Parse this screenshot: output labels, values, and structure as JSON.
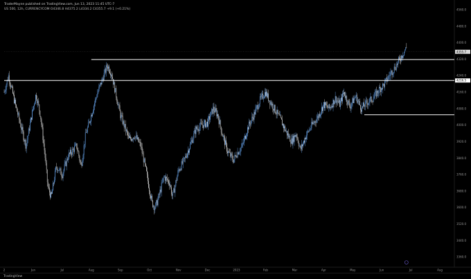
{
  "header": {
    "publisher": "TraderMayne published on TradingView.com, Jun 13, 2023 11:45 UTC-7",
    "ohlc": "US 500, 12h, CURRENCYCOM  O4346.8  H4375.2  L4334.2  C4355.7  +9.1 (+0.21%)"
  },
  "footer": {
    "brand": "TradingView",
    "time_marker": "Jun 13"
  },
  "colors": {
    "background": "#000000",
    "candle_up": "#6fb1ff",
    "candle_down": "#e8e8e8",
    "level_line": "#ffffff",
    "axis_text": "#9a9a9a"
  },
  "chart_data": {
    "type": "candlestick",
    "symbol": "US 500",
    "interval": "12h",
    "ylim": [
      3310,
      4560
    ],
    "y_ticks": [
      "4560.0",
      "4480.0",
      "4400.0",
      "4320.0",
      "4240.0",
      "4160.0",
      "4080.0",
      "4000.0",
      "3920.0",
      "3840.0",
      "3760.0",
      "3680.0",
      "3600.0",
      "3520.0",
      "3440.0",
      "3360.0"
    ],
    "x_ticks": [
      "2",
      "Jun",
      "Jul",
      "Aug",
      "Sep",
      "Oct",
      "Nov",
      "Dec",
      "2023",
      "Feb",
      "Mar",
      "Apr",
      "May",
      "Jun",
      "Jul",
      "Aug"
    ],
    "last_price_label": "4355.7",
    "horizontal_levels": [
      {
        "price": 4318,
        "label": "",
        "from_month": 3.0,
        "to_month": 15.5
      },
      {
        "price": 4216.5,
        "label": "4216.5",
        "from_month": 0.0,
        "to_month": 15.5
      },
      {
        "price": 4050,
        "label": "",
        "from_month": 12.4,
        "to_month": 15.5
      }
    ],
    "close_path": [
      [
        0.0,
        4160
      ],
      [
        0.15,
        4240
      ],
      [
        0.35,
        4120
      ],
      [
        0.55,
        4010
      ],
      [
        0.75,
        3900
      ],
      [
        0.95,
        4050
      ],
      [
        1.1,
        4150
      ],
      [
        1.25,
        4050
      ],
      [
        1.4,
        3860
      ],
      [
        1.5,
        3700
      ],
      [
        1.62,
        3650
      ],
      [
        1.8,
        3800
      ],
      [
        2.0,
        3760
      ],
      [
        2.2,
        3850
      ],
      [
        2.5,
        3900
      ],
      [
        2.65,
        3800
      ],
      [
        2.8,
        3950
      ],
      [
        3.0,
        4050
      ],
      [
        3.2,
        4150
      ],
      [
        3.4,
        4230
      ],
      [
        3.55,
        4290
      ],
      [
        3.7,
        4250
      ],
      [
        3.85,
        4150
      ],
      [
        4.0,
        4050
      ],
      [
        4.15,
        3990
      ],
      [
        4.3,
        3930
      ],
      [
        4.5,
        3950
      ],
      [
        4.7,
        3900
      ],
      [
        4.85,
        3800
      ],
      [
        5.0,
        3690
      ],
      [
        5.1,
        3620
      ],
      [
        5.2,
        3600
      ],
      [
        5.3,
        3640
      ],
      [
        5.5,
        3750
      ],
      [
        5.7,
        3720
      ],
      [
        5.8,
        3650
      ],
      [
        6.0,
        3780
      ],
      [
        6.2,
        3830
      ],
      [
        6.4,
        3900
      ],
      [
        6.6,
        3980
      ],
      [
        6.8,
        4000
      ],
      [
        7.0,
        4010
      ],
      [
        7.2,
        4080
      ],
      [
        7.35,
        4050
      ],
      [
        7.5,
        3960
      ],
      [
        7.7,
        3870
      ],
      [
        7.9,
        3830
      ],
      [
        8.0,
        3860
      ],
      [
        8.2,
        3900
      ],
      [
        8.4,
        3990
      ],
      [
        8.6,
        4050
      ],
      [
        8.8,
        4120
      ],
      [
        9.0,
        4160
      ],
      [
        9.1,
        4130
      ],
      [
        9.3,
        4080
      ],
      [
        9.5,
        4030
      ],
      [
        9.7,
        3970
      ],
      [
        9.9,
        3920
      ],
      [
        10.05,
        3960
      ],
      [
        10.2,
        3880
      ],
      [
        10.4,
        3950
      ],
      [
        10.6,
        4000
      ],
      [
        10.8,
        4040
      ],
      [
        11.0,
        4100
      ],
      [
        11.2,
        4080
      ],
      [
        11.4,
        4130
      ],
      [
        11.55,
        4100
      ],
      [
        11.7,
        4160
      ],
      [
        11.9,
        4090
      ],
      [
        12.1,
        4140
      ],
      [
        12.3,
        4080
      ],
      [
        12.5,
        4110
      ],
      [
        12.7,
        4130
      ],
      [
        12.9,
        4170
      ],
      [
        13.1,
        4200
      ],
      [
        13.3,
        4250
      ],
      [
        13.5,
        4290
      ],
      [
        13.7,
        4340
      ],
      [
        13.85,
        4375
      ]
    ]
  }
}
